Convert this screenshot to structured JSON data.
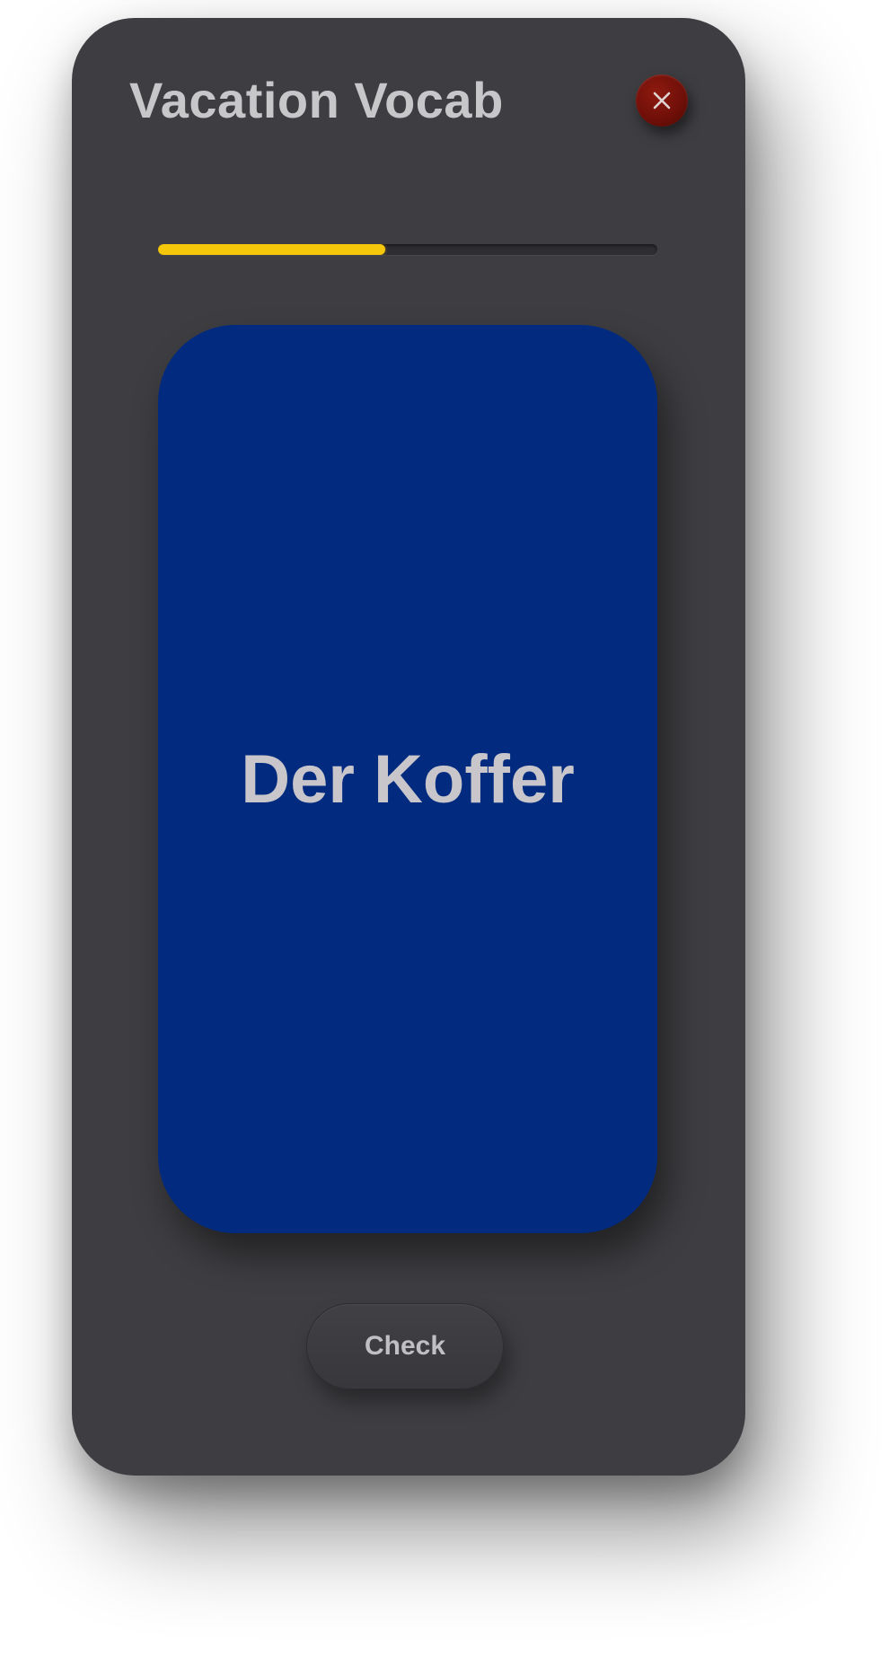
{
  "header": {
    "title": "Vacation Vocab",
    "close_icon": "close-icon",
    "close_color": "#7a1209"
  },
  "progress": {
    "fraction": 0.455,
    "color": "#f5c70a"
  },
  "card": {
    "word": "Der Koffer",
    "background": "#022b80"
  },
  "actions": {
    "check_label": "Check"
  }
}
